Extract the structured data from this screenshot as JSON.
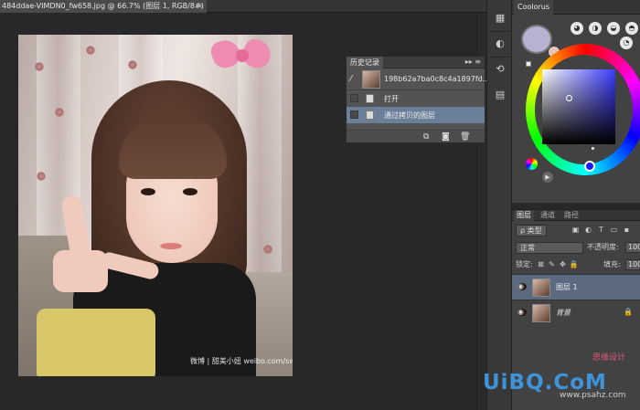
{
  "document": {
    "tab_title": "484ddae-VIMDN0_fw658.jpg @ 66.7% (图层 1, RGB/8#) *",
    "close_glyph": "×",
    "photo_watermark": "微博 | 甜美小妞 weibo.com/sweetgirlbaby"
  },
  "history_panel": {
    "tab_label": "历史记录",
    "controls": "▸▸ ≡",
    "snapshot_name": "198b62a7ba0c8c4a1897fd...",
    "items": [
      {
        "label": "打开",
        "selected": false
      },
      {
        "label": "通过拷贝的图层",
        "selected": true
      }
    ],
    "footer_icons": [
      "new-document-from-state-icon",
      "camera-icon",
      "trash-icon"
    ]
  },
  "coolorus": {
    "title": "Coolorus",
    "primary_color": "#b5b3d1",
    "secondary_color": "#e7c4bc",
    "hue_color": "#1a1aff"
  },
  "layers_panel": {
    "tabs": [
      "图层",
      "通道",
      "路径"
    ],
    "filter_kind": "ρ 类型",
    "blend_mode": "正常",
    "opacity_label": "不透明度:",
    "opacity_value": "100%",
    "lock_label": "锁定:",
    "fill_label": "填充:",
    "fill_value": "100%",
    "layers": [
      {
        "name": "图层 1",
        "selected": true,
        "locked": false
      },
      {
        "name": "背景",
        "selected": false,
        "locked": true
      }
    ]
  },
  "site_watermark": {
    "logo": "UiBQ.CoM",
    "url": "www.psahz.com",
    "cn": "思缘设计"
  }
}
